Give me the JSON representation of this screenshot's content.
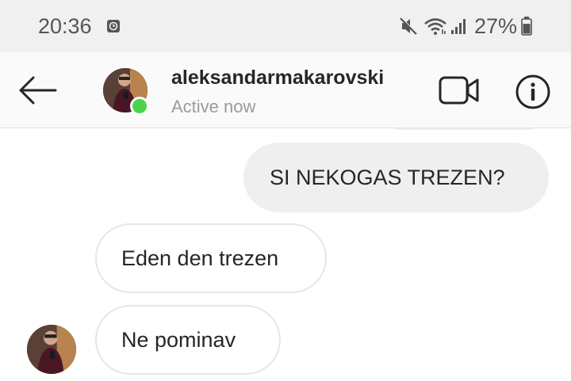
{
  "status_bar": {
    "time": "20:36",
    "battery": "27%",
    "icons": [
      "app-notification-icon",
      "mute-icon",
      "wifi-icon",
      "signal-icon",
      "battery-icon"
    ]
  },
  "header": {
    "username": "aleksandarmakarovski",
    "status": "Active now",
    "icons": [
      "back-arrow-icon",
      "video-call-icon",
      "info-icon"
    ],
    "active_color": "#4bd34b"
  },
  "messages": [
    {
      "side": "outgoing",
      "text": "SI NEKOGAS TREZEN?"
    },
    {
      "side": "incoming",
      "text": "Eden den trezen"
    },
    {
      "side": "incoming",
      "text": "Ne pominav"
    }
  ],
  "colors": {
    "status_bar_bg": "#f0f0f0",
    "outgoing_bubble": "#efefef",
    "incoming_border": "#e6e6e6",
    "text": "#262626"
  }
}
